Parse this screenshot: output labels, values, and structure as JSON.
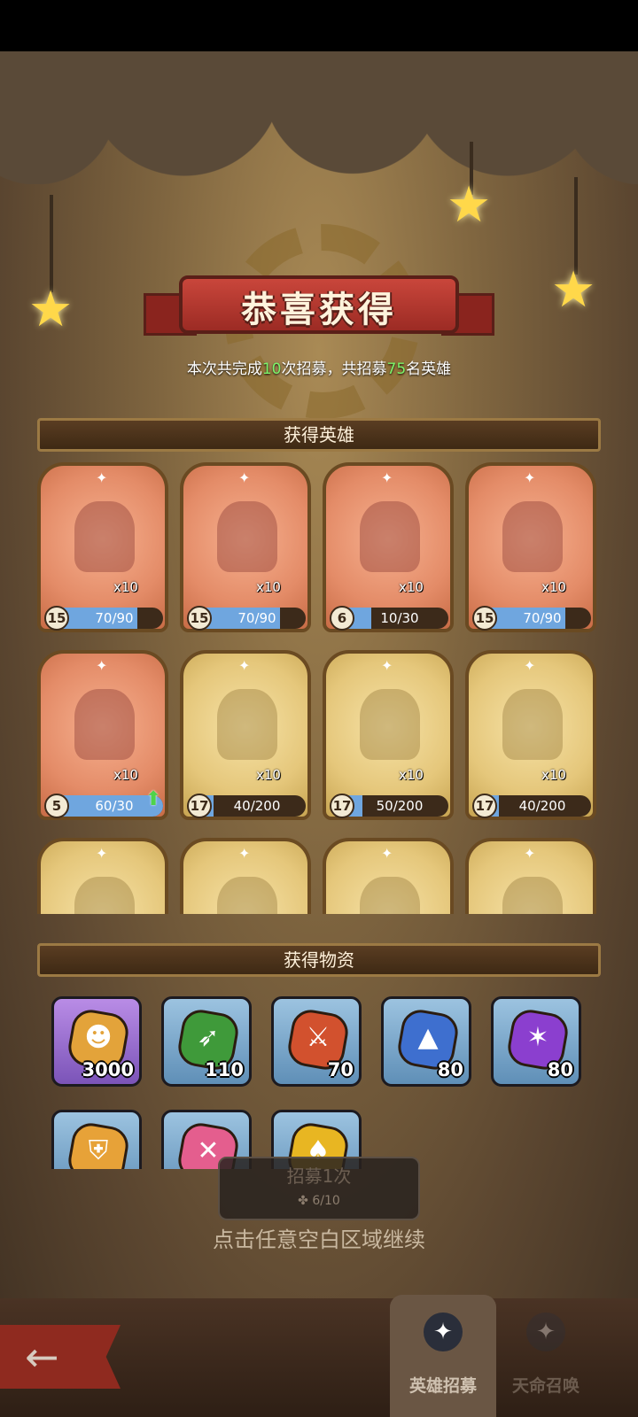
{
  "banner": {
    "title": "恭喜获得"
  },
  "summary": {
    "prefix": "本次共完成",
    "times": "10",
    "mid": "次招募，共招募",
    "heroes": "75",
    "suffix": "名英雄"
  },
  "sections": {
    "heroes_title": "获得英雄",
    "items_title": "获得物资"
  },
  "hero_cards": [
    {
      "tier": "orange",
      "count": "x10",
      "level": "15",
      "progress": "70/90",
      "fill": 0.78
    },
    {
      "tier": "orange",
      "count": "x10",
      "level": "15",
      "progress": "70/90",
      "fill": 0.78
    },
    {
      "tier": "orange",
      "count": "x10",
      "level": "6",
      "progress": "10/30",
      "fill": 0.33
    },
    {
      "tier": "orange",
      "count": "x10",
      "level": "15",
      "progress": "70/90",
      "fill": 0.78
    },
    {
      "tier": "orange",
      "count": "x10",
      "level": "5",
      "progress": "60/30",
      "fill": 1.0,
      "upgradable": true
    },
    {
      "tier": "gold",
      "count": "x10",
      "level": "17",
      "progress": "40/200",
      "fill": 0.2
    },
    {
      "tier": "gold",
      "count": "x10",
      "level": "17",
      "progress": "50/200",
      "fill": 0.25
    },
    {
      "tier": "gold",
      "count": "x10",
      "level": "17",
      "progress": "40/200",
      "fill": 0.2
    },
    {
      "tier": "gold"
    },
    {
      "tier": "gold"
    },
    {
      "tier": "gold"
    },
    {
      "tier": "gold"
    }
  ],
  "items": [
    {
      "frame": "purple",
      "gem_color": "#e3a33a",
      "icon": "coin-icon",
      "qty": "3000"
    },
    {
      "frame": "blue",
      "gem_color": "#3f9a3a",
      "icon": "bow-icon",
      "qty": "110"
    },
    {
      "frame": "blue",
      "gem_color": "#d2512e",
      "icon": "sword-icon",
      "qty": "70"
    },
    {
      "frame": "blue",
      "gem_color": "#3e6fcf",
      "icon": "wizard-hat-icon",
      "qty": "80"
    },
    {
      "frame": "blue",
      "gem_color": "#8b3fcf",
      "icon": "shuriken-icon",
      "qty": "80"
    },
    {
      "frame": "blue",
      "gem_color": "#e7a238",
      "icon": "shield-icon",
      "qty": ""
    },
    {
      "frame": "blue",
      "gem_color": "#e45e8e",
      "icon": "cross-icon",
      "qty": ""
    },
    {
      "frame": "blue",
      "gem_color": "#e8b622",
      "icon": "spade-coin-icon",
      "qty": ""
    }
  ],
  "recruit_button": {
    "label": "招募1次",
    "cost": "6/10"
  },
  "continue_hint": "点击任意空白区域继续",
  "tabs": [
    {
      "label": "英雄招募",
      "active": true
    },
    {
      "label": "天命召唤",
      "active": false
    }
  ]
}
